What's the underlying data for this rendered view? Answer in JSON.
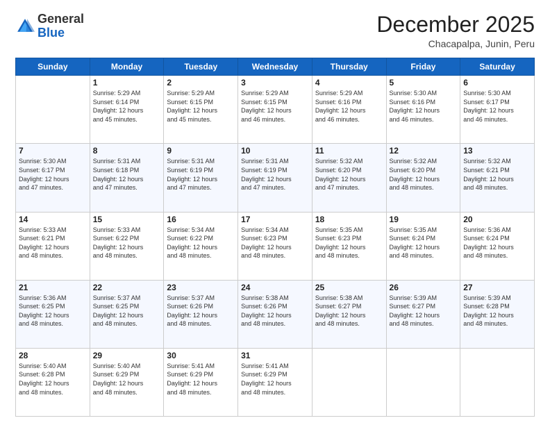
{
  "header": {
    "logo_general": "General",
    "logo_blue": "Blue",
    "month_title": "December 2025",
    "location": "Chacapalpa, Junin, Peru"
  },
  "days_of_week": [
    "Sunday",
    "Monday",
    "Tuesday",
    "Wednesday",
    "Thursday",
    "Friday",
    "Saturday"
  ],
  "weeks": [
    [
      {
        "day": "",
        "info": ""
      },
      {
        "day": "1",
        "info": "Sunrise: 5:29 AM\nSunset: 6:14 PM\nDaylight: 12 hours\nand 45 minutes."
      },
      {
        "day": "2",
        "info": "Sunrise: 5:29 AM\nSunset: 6:15 PM\nDaylight: 12 hours\nand 45 minutes."
      },
      {
        "day": "3",
        "info": "Sunrise: 5:29 AM\nSunset: 6:15 PM\nDaylight: 12 hours\nand 46 minutes."
      },
      {
        "day": "4",
        "info": "Sunrise: 5:29 AM\nSunset: 6:16 PM\nDaylight: 12 hours\nand 46 minutes."
      },
      {
        "day": "5",
        "info": "Sunrise: 5:30 AM\nSunset: 6:16 PM\nDaylight: 12 hours\nand 46 minutes."
      },
      {
        "day": "6",
        "info": "Sunrise: 5:30 AM\nSunset: 6:17 PM\nDaylight: 12 hours\nand 46 minutes."
      }
    ],
    [
      {
        "day": "7",
        "info": "Sunrise: 5:30 AM\nSunset: 6:17 PM\nDaylight: 12 hours\nand 47 minutes."
      },
      {
        "day": "8",
        "info": "Sunrise: 5:31 AM\nSunset: 6:18 PM\nDaylight: 12 hours\nand 47 minutes."
      },
      {
        "day": "9",
        "info": "Sunrise: 5:31 AM\nSunset: 6:19 PM\nDaylight: 12 hours\nand 47 minutes."
      },
      {
        "day": "10",
        "info": "Sunrise: 5:31 AM\nSunset: 6:19 PM\nDaylight: 12 hours\nand 47 minutes."
      },
      {
        "day": "11",
        "info": "Sunrise: 5:32 AM\nSunset: 6:20 PM\nDaylight: 12 hours\nand 47 minutes."
      },
      {
        "day": "12",
        "info": "Sunrise: 5:32 AM\nSunset: 6:20 PM\nDaylight: 12 hours\nand 48 minutes."
      },
      {
        "day": "13",
        "info": "Sunrise: 5:32 AM\nSunset: 6:21 PM\nDaylight: 12 hours\nand 48 minutes."
      }
    ],
    [
      {
        "day": "14",
        "info": "Sunrise: 5:33 AM\nSunset: 6:21 PM\nDaylight: 12 hours\nand 48 minutes."
      },
      {
        "day": "15",
        "info": "Sunrise: 5:33 AM\nSunset: 6:22 PM\nDaylight: 12 hours\nand 48 minutes."
      },
      {
        "day": "16",
        "info": "Sunrise: 5:34 AM\nSunset: 6:22 PM\nDaylight: 12 hours\nand 48 minutes."
      },
      {
        "day": "17",
        "info": "Sunrise: 5:34 AM\nSunset: 6:23 PM\nDaylight: 12 hours\nand 48 minutes."
      },
      {
        "day": "18",
        "info": "Sunrise: 5:35 AM\nSunset: 6:23 PM\nDaylight: 12 hours\nand 48 minutes."
      },
      {
        "day": "19",
        "info": "Sunrise: 5:35 AM\nSunset: 6:24 PM\nDaylight: 12 hours\nand 48 minutes."
      },
      {
        "day": "20",
        "info": "Sunrise: 5:36 AM\nSunset: 6:24 PM\nDaylight: 12 hours\nand 48 minutes."
      }
    ],
    [
      {
        "day": "21",
        "info": "Sunrise: 5:36 AM\nSunset: 6:25 PM\nDaylight: 12 hours\nand 48 minutes."
      },
      {
        "day": "22",
        "info": "Sunrise: 5:37 AM\nSunset: 6:25 PM\nDaylight: 12 hours\nand 48 minutes."
      },
      {
        "day": "23",
        "info": "Sunrise: 5:37 AM\nSunset: 6:26 PM\nDaylight: 12 hours\nand 48 minutes."
      },
      {
        "day": "24",
        "info": "Sunrise: 5:38 AM\nSunset: 6:26 PM\nDaylight: 12 hours\nand 48 minutes."
      },
      {
        "day": "25",
        "info": "Sunrise: 5:38 AM\nSunset: 6:27 PM\nDaylight: 12 hours\nand 48 minutes."
      },
      {
        "day": "26",
        "info": "Sunrise: 5:39 AM\nSunset: 6:27 PM\nDaylight: 12 hours\nand 48 minutes."
      },
      {
        "day": "27",
        "info": "Sunrise: 5:39 AM\nSunset: 6:28 PM\nDaylight: 12 hours\nand 48 minutes."
      }
    ],
    [
      {
        "day": "28",
        "info": "Sunrise: 5:40 AM\nSunset: 6:28 PM\nDaylight: 12 hours\nand 48 minutes."
      },
      {
        "day": "29",
        "info": "Sunrise: 5:40 AM\nSunset: 6:29 PM\nDaylight: 12 hours\nand 48 minutes."
      },
      {
        "day": "30",
        "info": "Sunrise: 5:41 AM\nSunset: 6:29 PM\nDaylight: 12 hours\nand 48 minutes."
      },
      {
        "day": "31",
        "info": "Sunrise: 5:41 AM\nSunset: 6:29 PM\nDaylight: 12 hours\nand 48 minutes."
      },
      {
        "day": "",
        "info": ""
      },
      {
        "day": "",
        "info": ""
      },
      {
        "day": "",
        "info": ""
      }
    ]
  ]
}
